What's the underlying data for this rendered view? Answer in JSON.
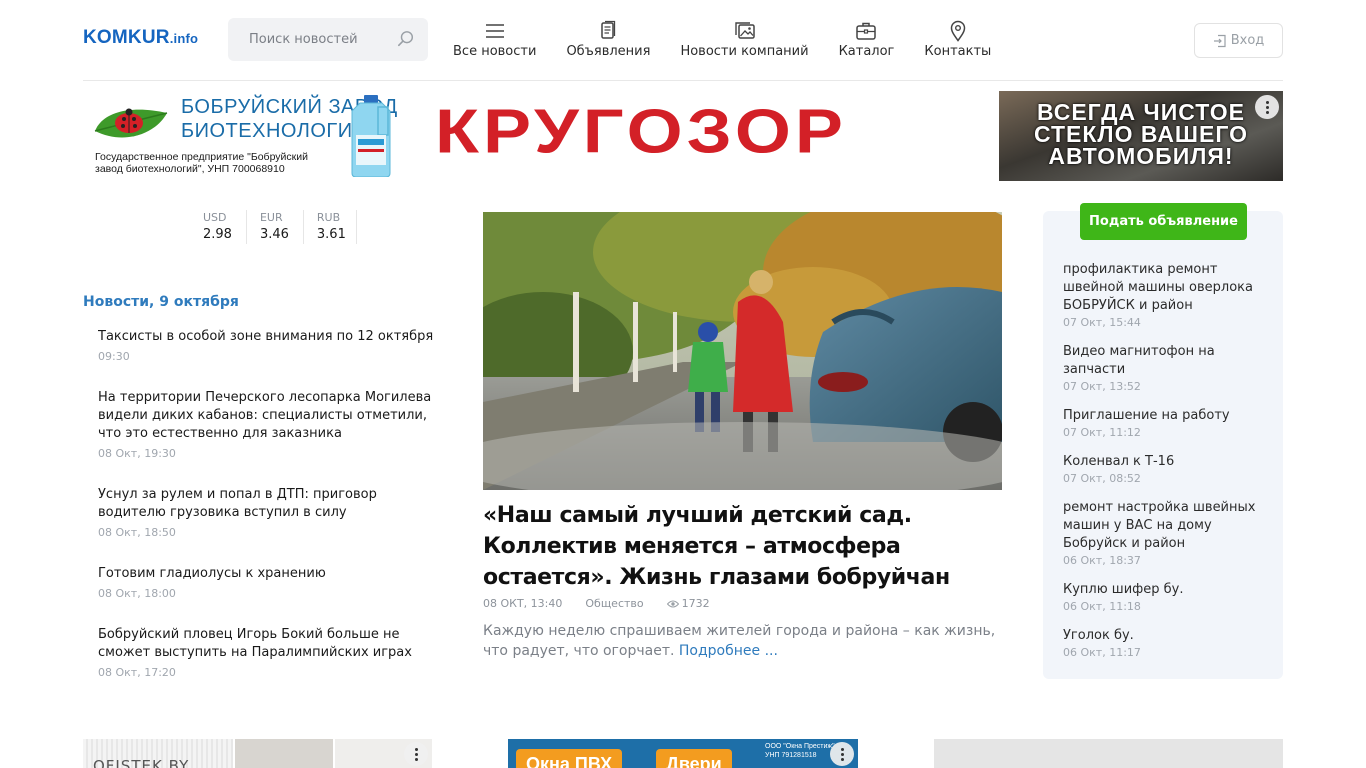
{
  "header": {
    "logo_main": "KOMKUR",
    "logo_suffix": ".info",
    "search_placeholder": "Поиск новостей",
    "nav": [
      {
        "label": "Все новости",
        "icon": "menu-icon"
      },
      {
        "label": "Объявления",
        "icon": "documents-icon"
      },
      {
        "label": "Новости компаний",
        "icon": "gallery-icon"
      },
      {
        "label": "Каталог",
        "icon": "briefcase-icon"
      },
      {
        "label": "Контакты",
        "icon": "map-pin-icon"
      }
    ],
    "login_label": "Вход"
  },
  "banner": {
    "factory_title": "БОБРУЙСКИЙ ЗАВОД\nБИОТЕХНОЛОГИЙ",
    "factory_sub": "Государственное предприятие \"Бобруйский завод биотехнологий\", УНП 700068910",
    "brand": "КРУГОЗОР",
    "right_text": "ВСЕГДА ЧИСТОЕ\nСТЕКЛО ВАШЕГО\nАВТОМОБИЛЯ!"
  },
  "currency": [
    {
      "code": "USD",
      "value": "2.98"
    },
    {
      "code": "EUR",
      "value": "3.46"
    },
    {
      "code": "RUB",
      "value": "3.61"
    }
  ],
  "news": {
    "heading": "Новости, 9 октября",
    "items": [
      {
        "title": "Таксисты в особой зоне внимания по 12 октября",
        "time": "09:30"
      },
      {
        "title": "На территории Печерского лесопарка Могилева видели диких кабанов: специалисты отметили, что это естественно для заказника",
        "time": "08 Окт, 19:30"
      },
      {
        "title": "Уснул за рулем и попал в ДТП: приговор водителю грузовика вступил в силу",
        "time": "08 Окт, 18:50"
      },
      {
        "title": "Готовим гладиолусы к хранению",
        "time": "08 Окт, 18:00"
      },
      {
        "title": "Бобруйский пловец Игорь Бокий больше не сможет выступить на Паралимпийских играх",
        "time": "08 Окт, 17:20"
      }
    ]
  },
  "main": {
    "title": "«Наш самый лучший детский сад. Коллектив меняется – атмосфера остается». Жизнь глазами бобруйчан",
    "date": "08 ОКТ, 13:40",
    "category": "Общество",
    "views": "1732",
    "lead": "Каждую неделю спрашиваем жителей города и района – как жизнь, что радует, что огорчает.",
    "more": "Подробнее ..."
  },
  "classifieds": {
    "submit_label": "Подать объявление",
    "items": [
      {
        "title": "профилактика ремонт швейной машины оверлока БОБРУЙСК и район",
        "date": "07 Окт, 15:44"
      },
      {
        "title": "Видео магнитофон на запчасти",
        "date": "07 Окт, 13:52"
      },
      {
        "title": "Приглашение на работу",
        "date": "07 Окт, 11:12"
      },
      {
        "title": "Коленвал к Т-16",
        "date": "07 Окт, 08:52"
      },
      {
        "title": "ремонт настройка швейных машин у ВАС на дому Бобруйск и район",
        "date": "06 Окт, 18:37"
      },
      {
        "title": "Куплю шифер бу.",
        "date": "06 Окт, 11:18"
      },
      {
        "title": "Уголок бу.",
        "date": "06 Окт, 11:17"
      }
    ]
  },
  "bottom_ads": {
    "ad1_text": "OFISTEK.BY",
    "ad2_btn1": "Окна ПВХ",
    "ad2_btn2": "Двери",
    "ad2_company": "ООО \"Окна Престиж\"\nУНП 791281518"
  },
  "colors": {
    "brand_blue": "#1565c0",
    "link_blue": "#2f7bbd",
    "green_button": "#3fb618",
    "krugozor_red": "#d32027"
  }
}
